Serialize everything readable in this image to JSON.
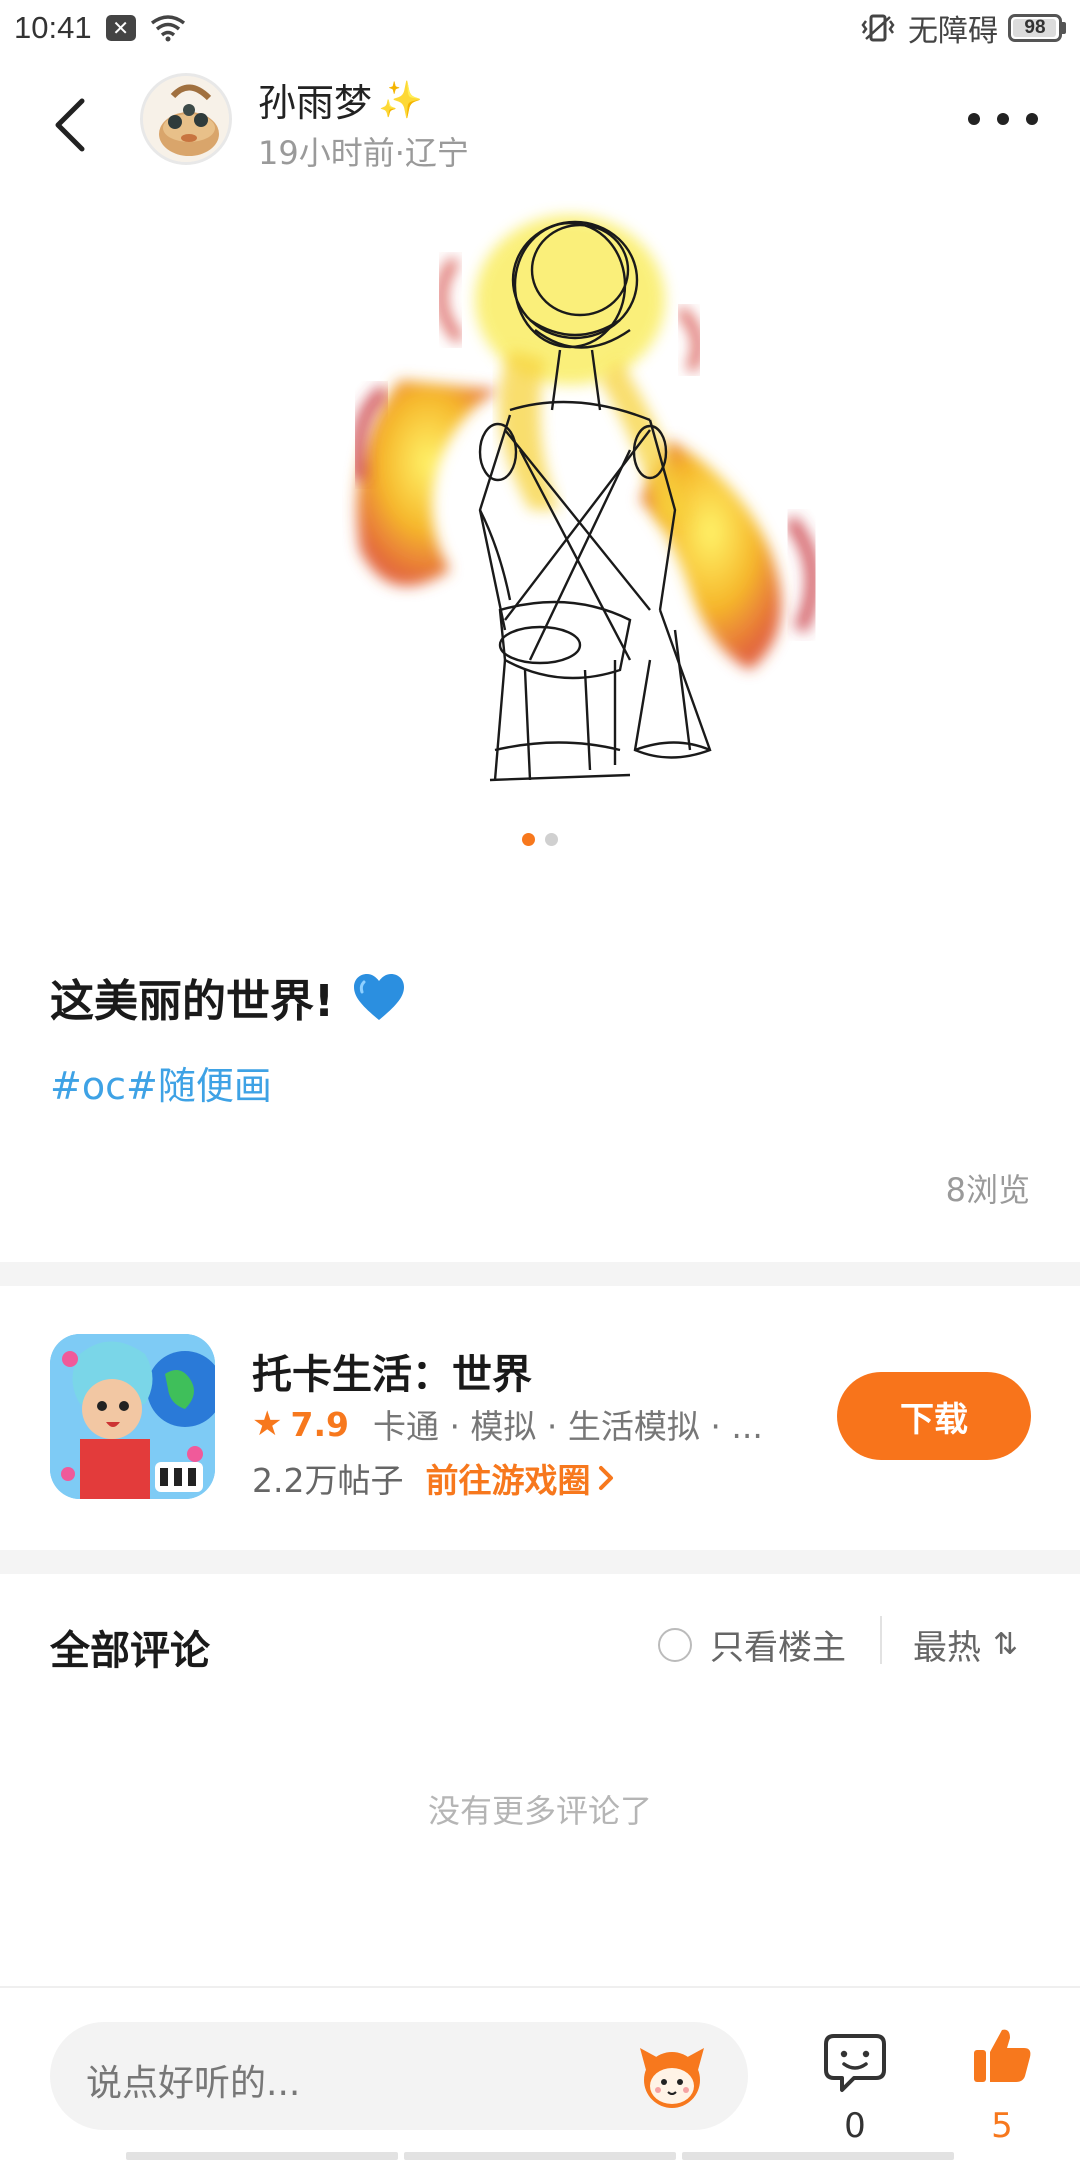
{
  "status_bar": {
    "time": "10:41",
    "accessibility": "无障碍",
    "battery": "98",
    "battery_level": 0.98
  },
  "header": {
    "author_name": "孙雨梦",
    "author_badge": "✨",
    "post_meta": "19小时前·辽宁",
    "back_icon": "chevron-left-icon",
    "more_icon": "more-horizontal-icon"
  },
  "post": {
    "image_count": 2,
    "active_image_index": 0,
    "title": "这美丽的世界!",
    "title_emoji": "blue-heart",
    "tags": "#oc#随便画",
    "views": "8浏览"
  },
  "game": {
    "name": "托卡生活：世界",
    "rating": "7.9",
    "genres": "卡通 · 模拟 · 生活模拟 · ...",
    "posts": "2.2万帖子",
    "goto_label": "前往游戏圈",
    "download_label": "下载"
  },
  "comments": {
    "title": "全部评论",
    "owner_only_label": "只看楼主",
    "sort_label": "最热",
    "empty_text": "没有更多评论了"
  },
  "bottom_bar": {
    "input_placeholder": "说点好听的...",
    "comment_count": "0",
    "like_count": "5"
  },
  "colors": {
    "accent": "#f7781d",
    "tag": "#3ea2e5",
    "muted": "#9a9a9a"
  }
}
